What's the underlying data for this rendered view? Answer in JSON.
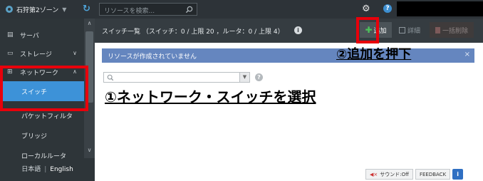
{
  "topbar": {
    "zone_label": "石狩第2ゾーン",
    "search_placeholder": "リソースを検索..."
  },
  "sidebar": {
    "items": [
      {
        "label": "サーバ",
        "icon": "server-icon",
        "expandable": false
      },
      {
        "label": "ストレージ",
        "icon": "storage-icon",
        "expandable": true,
        "chevron": "∨"
      },
      {
        "label": "ネットワーク",
        "icon": "network-icon",
        "expandable": true,
        "chevron": "∧"
      }
    ],
    "network_children": [
      {
        "label": "スイッチ",
        "active": true
      },
      {
        "label": "パケットフィルタ",
        "active": false
      },
      {
        "label": "ブリッジ",
        "active": false
      },
      {
        "label": "ローカルルータ",
        "active": false
      }
    ],
    "languages": {
      "japanese": "日本語",
      "separator": "|",
      "english": "English",
      "selected": "English"
    }
  },
  "main": {
    "title": "スイッチ一覧 （スイッチ：0 / 上限 20 ，ルータ：0 / 上限 4）",
    "toolbar": {
      "add_label": "追加",
      "detail_label": "詳細",
      "delete_label": "一括削除"
    },
    "notice": "リソースが作成されていません",
    "filter_placeholder": ""
  },
  "annotations": {
    "step1": "①ネットワーク・スイッチを選択",
    "step2": "②追加を押下"
  },
  "footer": {
    "sound_label": "サウンド:Off",
    "feedback_label": "FEEDBACK",
    "info_label": "i"
  },
  "colors": {
    "topbar_bg": "#2d3338",
    "sidebar_bg": "#2e3539",
    "active_item": "#3d92d8",
    "notice_bg": "#6586bf",
    "add_icon": "#4cc25b",
    "highlight_border": "#e8000b"
  }
}
